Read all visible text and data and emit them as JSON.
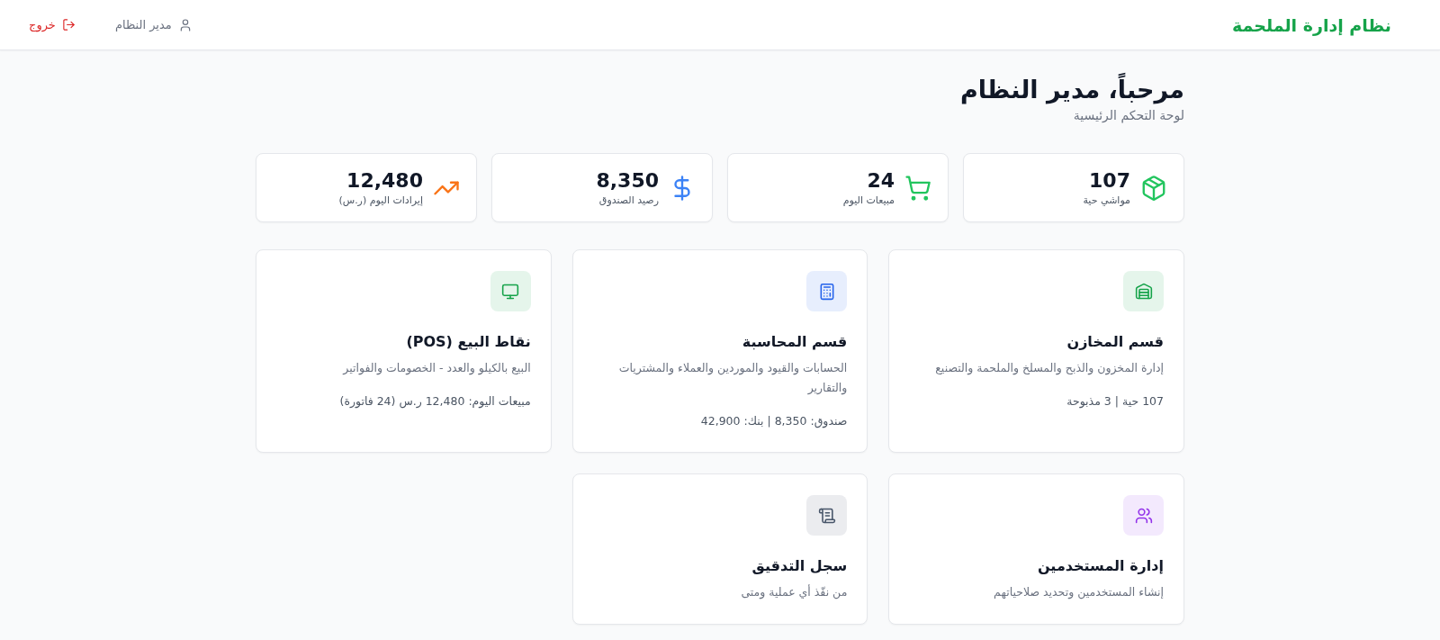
{
  "header": {
    "title": "نظام إدارة الملحمة",
    "user": "مدير النظام",
    "logout": "خروج"
  },
  "greeting": {
    "title": "مرحباً، مدير النظام",
    "subtitle": "لوحة التحكم الرئيسية"
  },
  "stats": [
    {
      "value": "107",
      "label": "مواشي حية",
      "color": "#22c55e"
    },
    {
      "value": "24",
      "label": "مبيعات اليوم",
      "color": "#22c55e"
    },
    {
      "value": "8,350",
      "label": "رصيد الصندوق",
      "color": "#3b82f6"
    },
    {
      "value": "12,480",
      "label": "إيرادات اليوم (ر.س)",
      "color": "#f97316"
    }
  ],
  "modules": [
    {
      "title": "قسم المخازن",
      "description": "إدارة المخزون والذبح والمسلخ والملحمة والتصنيع",
      "footer": "107 حية | 3 مذبوحة",
      "color": "#16a34a"
    },
    {
      "title": "قسم المحاسبة",
      "description": "الحسابات والقيود والموردين والعملاء والمشتريات والتقارير",
      "footer": "صندوق: 8,350 | بنك: 42,900",
      "color": "#2563eb"
    },
    {
      "title": "نقاط البيع (POS)",
      "description": "البيع بالكيلو والعدد - الخصومات والفواتير",
      "footer": "مبيعات اليوم: 12,480 ر.س (24 فاتورة)",
      "color": "#16a34a"
    },
    {
      "title": "إدارة المستخدمين",
      "description": "إنشاء المستخدمين وتحديد صلاحياتهم",
      "color": "#9333ea"
    },
    {
      "title": "سجل التدقيق",
      "description": "من نفّذ أي عملية ومتى",
      "color": "#475569"
    }
  ]
}
